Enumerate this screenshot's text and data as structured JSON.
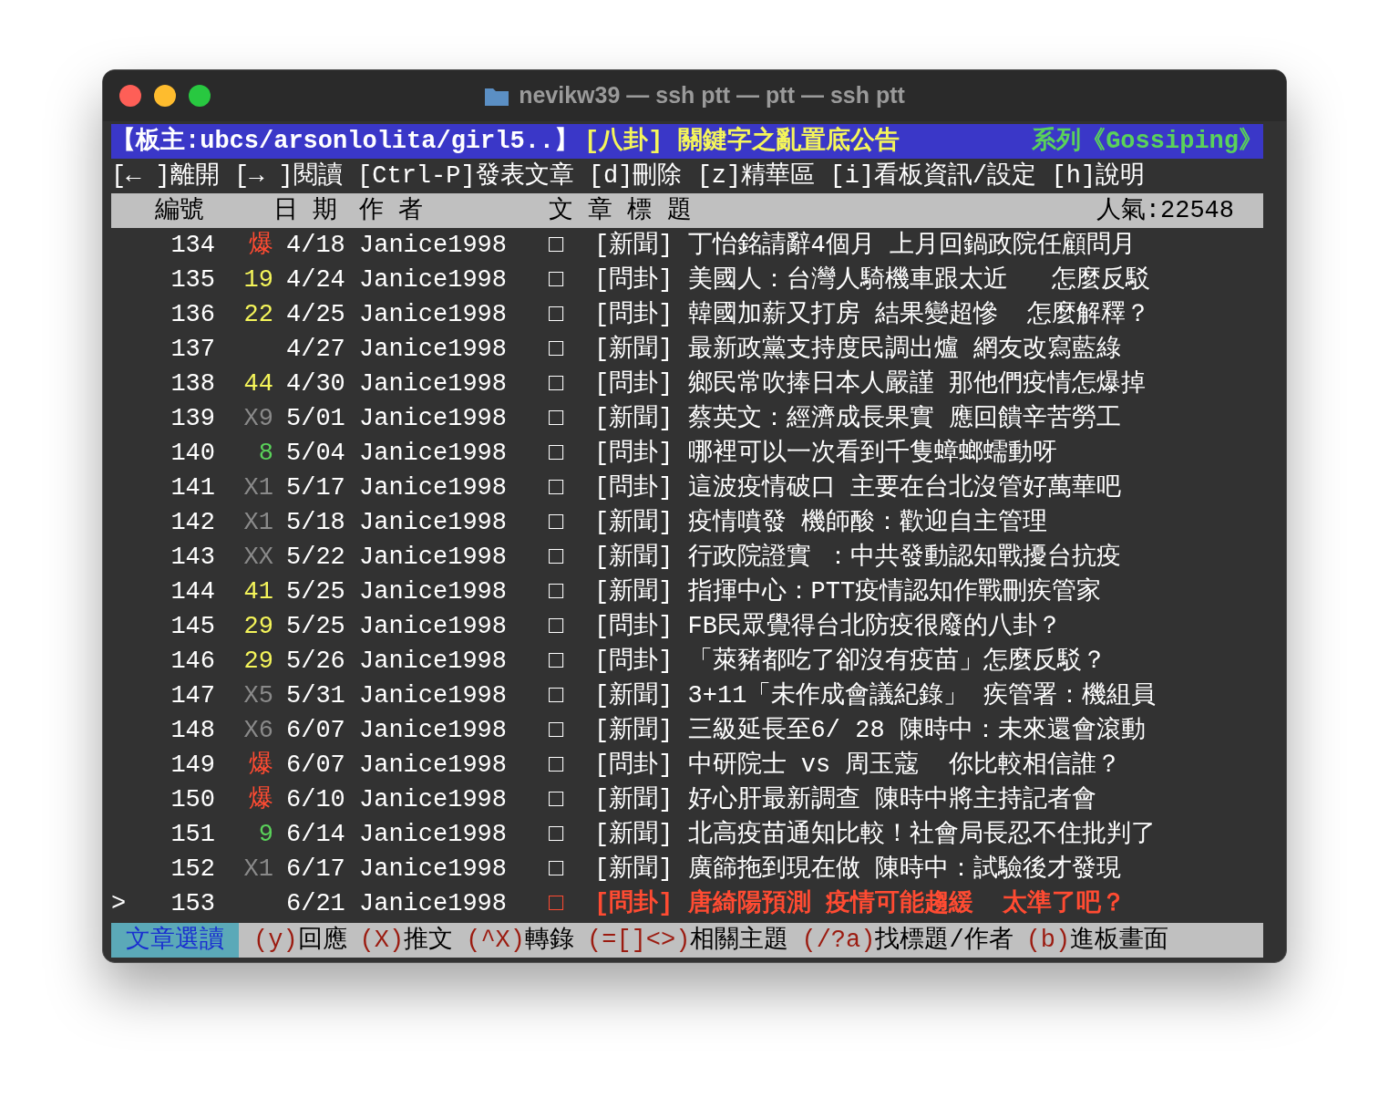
{
  "window": {
    "title": "nevikw39 — ssh ptt — ptt — ssh ptt"
  },
  "board_header": {
    "moderator": "【板主:ubcs/arsonlolita/girl5..】",
    "notice": "[八卦] 關鍵字之亂置底公告",
    "series": "系列《Gossiping》"
  },
  "menu": "[← ]離開 [→ ]閱讀 [Ctrl-P]發表文章 [d]刪除 [z]精華區 [i]看板資訊/設定 [h]說明",
  "columns": {
    "number": "編號",
    "date": "日 期",
    "author": "作 者",
    "title": "文 章 標 題",
    "popularity": "人氣:22548"
  },
  "cursor": ">",
  "rows": [
    {
      "number": "134",
      "recommend": {
        "text": "爆",
        "color": "#ff4b32"
      },
      "date": "4/18",
      "author": "Janice1998",
      "mark": "□",
      "title": "[新聞] 丁怡銘請辭4個月 上月回鍋政院任顧問月",
      "selected": false
    },
    {
      "number": "135",
      "recommend": {
        "text": "19",
        "color": "#f5f55a"
      },
      "date": "4/24",
      "author": "Janice1998",
      "mark": "□",
      "title": "[問卦] 美國人：台灣人騎機車跟太近   怎麼反駁",
      "selected": false
    },
    {
      "number": "136",
      "recommend": {
        "text": "22",
        "color": "#f5f55a"
      },
      "date": "4/25",
      "author": "Janice1998",
      "mark": "□",
      "title": "[問卦] 韓國加薪又打房 結果變超慘  怎麼解釋？",
      "selected": false
    },
    {
      "number": "137",
      "date": "4/27",
      "author": "Janice1998",
      "mark": "□",
      "title": "[新聞] 最新政黨支持度民調出爐 網友改寫藍綠",
      "selected": false
    },
    {
      "number": "138",
      "recommend": {
        "text": "44",
        "color": "#f5f55a"
      },
      "date": "4/30",
      "author": "Janice1998",
      "mark": "□",
      "title": "[問卦] 鄉民常吹捧日本人嚴謹 那他們疫情怎爆掉",
      "selected": false
    },
    {
      "number": "139",
      "recommend": {
        "text": "X9",
        "color": "#8a8a8a"
      },
      "date": "5/01",
      "author": "Janice1998",
      "mark": "□",
      "title": "[新聞] 蔡英文：經濟成長果實 應回饋辛苦勞工",
      "selected": false
    },
    {
      "number": "140",
      "recommend": {
        "text": "8",
        "color": "#5ad25a"
      },
      "date": "5/04",
      "author": "Janice1998",
      "mark": "□",
      "title": "[問卦] 哪裡可以一次看到千隻蟑螂蠕動呀",
      "selected": false
    },
    {
      "number": "141",
      "recommend": {
        "text": "X1",
        "color": "#8a8a8a"
      },
      "date": "5/17",
      "author": "Janice1998",
      "mark": "□",
      "title": "[問卦] 這波疫情破口 主要在台北沒管好萬華吧",
      "selected": false
    },
    {
      "number": "142",
      "recommend": {
        "text": "X1",
        "color": "#8a8a8a"
      },
      "date": "5/18",
      "author": "Janice1998",
      "mark": "□",
      "title": "[新聞] 疫情噴發 機師酸：歡迎自主管理",
      "selected": false
    },
    {
      "number": "143",
      "recommend": {
        "text": "XX",
        "color": "#8a8a8a"
      },
      "date": "5/22",
      "author": "Janice1998",
      "mark": "□",
      "title": "[新聞] 行政院證實 ：中共發動認知戰擾台抗疫",
      "selected": false
    },
    {
      "number": "144",
      "recommend": {
        "text": "41",
        "color": "#f5f55a"
      },
      "date": "5/25",
      "author": "Janice1998",
      "mark": "□",
      "title": "[新聞] 指揮中心：PTT疫情認知作戰刪疾管家",
      "selected": false
    },
    {
      "number": "145",
      "recommend": {
        "text": "29",
        "color": "#f5f55a"
      },
      "date": "5/25",
      "author": "Janice1998",
      "mark": "□",
      "title": "[問卦] FB民眾覺得台北防疫很廢的八卦？",
      "selected": false
    },
    {
      "number": "146",
      "recommend": {
        "text": "29",
        "color": "#f5f55a"
      },
      "date": "5/26",
      "author": "Janice1998",
      "mark": "□",
      "title": "[問卦] 「萊豬都吃了卻沒有疫苗」怎麼反駁？",
      "selected": false
    },
    {
      "number": "147",
      "recommend": {
        "text": "X5",
        "color": "#8a8a8a"
      },
      "date": "5/31",
      "author": "Janice1998",
      "mark": "□",
      "title": "[新聞] 3+11「未作成會議紀錄」 疾管署：機組員",
      "selected": false
    },
    {
      "number": "148",
      "recommend": {
        "text": "X6",
        "color": "#8a8a8a"
      },
      "date": "6/07",
      "author": "Janice1998",
      "mark": "□",
      "title": "[新聞] 三級延長至6/ 28 陳時中：未來還會滾動",
      "selected": false
    },
    {
      "number": "149",
      "recommend": {
        "text": "爆",
        "color": "#ff4b32"
      },
      "date": "6/07",
      "author": "Janice1998",
      "mark": "□",
      "title": "[問卦] 中研院士 vs 周玉蔻  你比較相信誰？",
      "selected": false
    },
    {
      "number": "150",
      "recommend": {
        "text": "爆",
        "color": "#ff4b32"
      },
      "date": "6/10",
      "author": "Janice1998",
      "mark": "□",
      "title": "[新聞] 好心肝最新調查 陳時中將主持記者會",
      "selected": false
    },
    {
      "number": "151",
      "recommend": {
        "text": "9",
        "color": "#5ad25a"
      },
      "date": "6/14",
      "author": "Janice1998",
      "mark": "□",
      "title": "[新聞] 北高疫苗通知比較！社會局長忍不住批判了",
      "selected": false
    },
    {
      "number": "152",
      "recommend": {
        "text": "X1",
        "color": "#8a8a8a"
      },
      "date": "6/17",
      "author": "Janice1998",
      "mark": "□",
      "title": "[新聞] 廣篩拖到現在做 陳時中：試驗後才發現",
      "selected": false
    },
    {
      "number": "153",
      "date": "6/21",
      "author": "Janice1998",
      "mark": "□",
      "title": "[問卦] 唐綺陽預測 疫情可能趨緩  太準了吧？",
      "selected": true
    }
  ],
  "footer": {
    "mode": "文章選讀",
    "commands": [
      {
        "key": "(y)",
        "label": "回應"
      },
      {
        "key": "(X)",
        "label": "推文"
      },
      {
        "key": "(^X)",
        "label": "轉錄"
      },
      {
        "key": "(=[]<>)",
        "label": "相關主題"
      },
      {
        "key": "(/?a)",
        "label": "找標題/作者"
      },
      {
        "key": "(b)",
        "label": "進板畫面"
      }
    ]
  }
}
